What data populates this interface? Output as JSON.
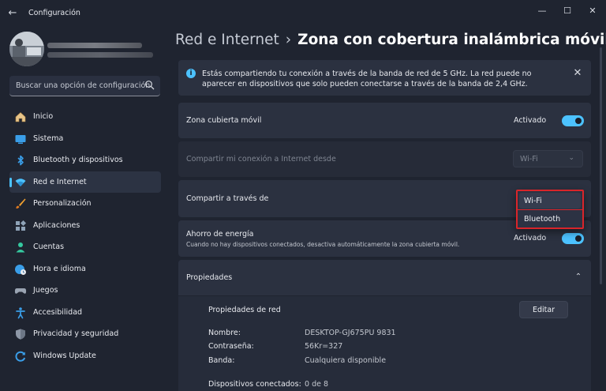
{
  "window": {
    "title": "Configuración",
    "back_glyph": "←",
    "minimize_glyph": "—",
    "maximize_glyph": "☐",
    "close_glyph": "✕"
  },
  "sidebar": {
    "search_placeholder": "Buscar una opción de configuración",
    "items": [
      {
        "label": "Inicio",
        "icon": "home-icon"
      },
      {
        "label": "Sistema",
        "icon": "system-icon"
      },
      {
        "label": "Bluetooth y dispositivos",
        "icon": "bluetooth-icon"
      },
      {
        "label": "Red e Internet",
        "icon": "network-icon",
        "active": true
      },
      {
        "label": "Personalización",
        "icon": "brush-icon"
      },
      {
        "label": "Aplicaciones",
        "icon": "apps-icon"
      },
      {
        "label": "Cuentas",
        "icon": "accounts-icon"
      },
      {
        "label": "Hora e idioma",
        "icon": "globe-clock-icon"
      },
      {
        "label": "Juegos",
        "icon": "gamepad-icon"
      },
      {
        "label": "Accesibilidad",
        "icon": "accessibility-icon"
      },
      {
        "label": "Privacidad y seguridad",
        "icon": "shield-icon"
      },
      {
        "label": "Windows Update",
        "icon": "update-icon"
      }
    ]
  },
  "breadcrumb": {
    "parent": "Red e Internet",
    "separator": "›",
    "current": "Zona con cobertura inalámbrica móvil"
  },
  "info_banner": {
    "text": "Estás compartiendo tu conexión a través de la banda de red de 5 GHz. La red puede no aparecer en dispositivos que solo pueden conectarse a través de la banda de 2,4 GHz.",
    "close_glyph": "✕"
  },
  "hotspot": {
    "label": "Zona cubierta móvil",
    "state": "Activado"
  },
  "share_from": {
    "label": "Compartir mi conexión a Internet desde",
    "value": "Wi-Fi",
    "chevron": "⌄"
  },
  "share_over": {
    "label": "Compartir a través de",
    "options": [
      "Wi-Fi",
      "Bluetooth"
    ]
  },
  "power_saving": {
    "label": "Ahorro de energía",
    "description": "Cuando no hay dispositivos conectados, desactiva automáticamente la zona cubierta móvil.",
    "state": "Activado"
  },
  "properties": {
    "header": "Propiedades",
    "chevron": "⌃",
    "network_props_label": "Propiedades de red",
    "edit_label": "Editar",
    "rows": [
      {
        "label": "Nombre:",
        "value": "DESKTOP-GJ675PU 9831"
      },
      {
        "label": "Contraseña:",
        "value": "56Kr=327"
      },
      {
        "label": "Banda:",
        "value": "Cualquiera disponible"
      },
      {
        "label": "Dispositivos conectados:",
        "value": "0 de 8"
      }
    ]
  },
  "colors": {
    "accent": "#4cc2ff",
    "background": "#1f2430",
    "card": "#2b3140",
    "highlight_border": "#d9252a"
  }
}
